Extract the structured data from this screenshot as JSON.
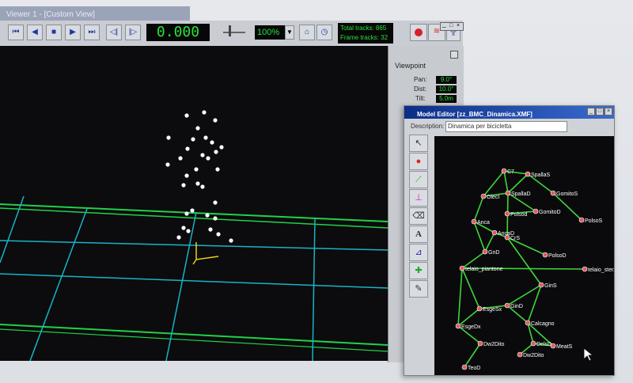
{
  "app": {
    "window_title": "Viewer 1 - [Custom View]"
  },
  "toolbar": {
    "time": "0.000",
    "zoom": "100%",
    "total_tracks_label": "Total tracks: 865",
    "frame_tracks_label": "Frame tracks: 32"
  },
  "viewpoint": {
    "title": "Viewpoint",
    "rows": [
      {
        "label": "Pan:",
        "value": "9.0°"
      },
      {
        "label": "Dist:",
        "value": "10.0°"
      },
      {
        "label": "Tilt:",
        "value": "5.0m"
      }
    ]
  },
  "editor": {
    "title": "Model Editor [zz_BMC_Dinamica.XMF]",
    "description_label": "Description:",
    "description_value": "Dinamica per bicicletta",
    "tools": [
      "select-icon",
      "marker-icon",
      "link-icon",
      "segment-icon",
      "eraser-icon",
      "text-icon",
      "axis-icon",
      "joint-icon",
      "pen-icon"
    ],
    "tool_text": "A",
    "nodes": [
      {
        "label": "C7"
      },
      {
        "label": "SpallaS"
      },
      {
        "label": "OlecI"
      },
      {
        "label": "SpallaD"
      },
      {
        "label": "GomitoS"
      },
      {
        "label": "GomitoD"
      },
      {
        "label": "PolsoS"
      },
      {
        "label": "Polsod"
      },
      {
        "label": "Anca"
      },
      {
        "label": "AncaD"
      },
      {
        "label": "CrS"
      },
      {
        "label": "PolsoD"
      },
      {
        "label": "GnD"
      },
      {
        "label": "telaio_piantone"
      },
      {
        "label": "telaio_sterzo"
      },
      {
        "label": "GinS"
      },
      {
        "label": "GinD"
      },
      {
        "label": "EsgeSx"
      },
      {
        "label": "EsgeDx"
      },
      {
        "label": "Calcagno"
      },
      {
        "label": "DelsD"
      },
      {
        "label": "Dw2Dito"
      },
      {
        "label": "TeoD"
      },
      {
        "label": "Dw2Dito"
      },
      {
        "label": "MeatS"
      }
    ]
  },
  "colors": {
    "viewport_bg": "#0c0b0d",
    "grid_cyan": "#14b5c8",
    "grid_green": "#1fd24a",
    "marker": "#ffffff",
    "link_green": "#3ed63a",
    "node_red": "#e05a66"
  }
}
